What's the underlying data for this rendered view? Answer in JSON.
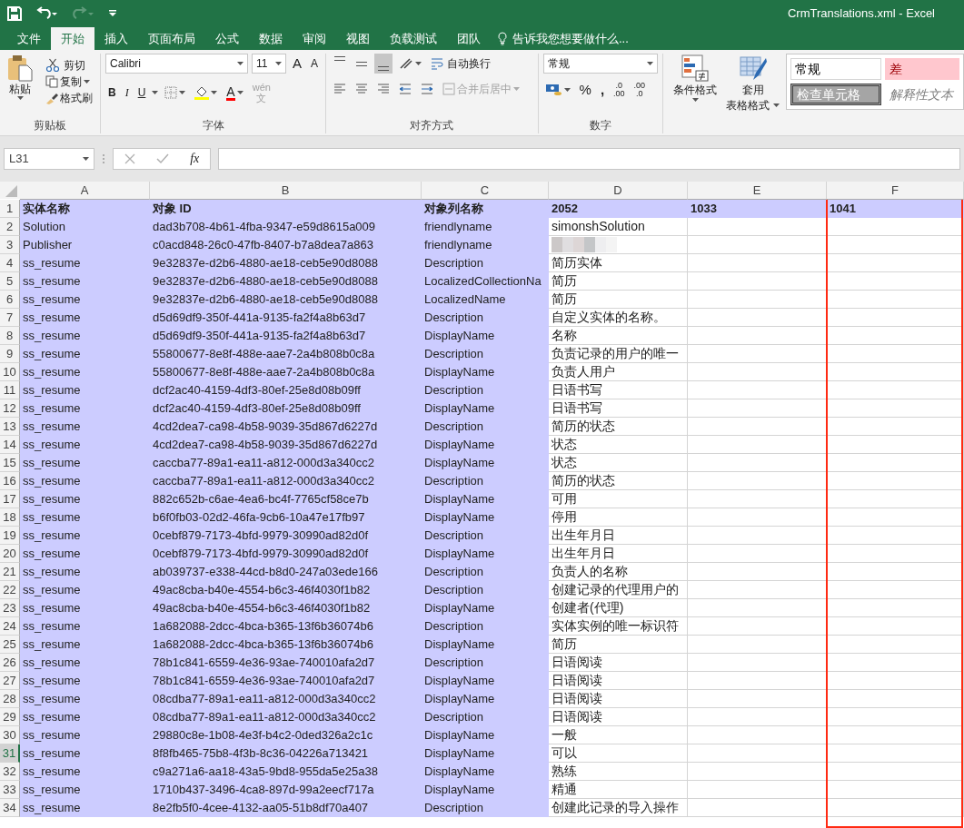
{
  "window": {
    "title": "CrmTranslations.xml - Excel"
  },
  "quick_access": [
    {
      "kind": "save",
      "disabled": false
    },
    {
      "kind": "undo",
      "disabled": false
    },
    {
      "kind": "redo",
      "disabled": true
    },
    {
      "kind": "customize",
      "disabled": false
    }
  ],
  "tabs": [
    {
      "label": "文件",
      "selected": false
    },
    {
      "label": "开始",
      "selected": true
    },
    {
      "label": "插入",
      "selected": false
    },
    {
      "label": "页面布局",
      "selected": false
    },
    {
      "label": "公式",
      "selected": false
    },
    {
      "label": "数据",
      "selected": false
    },
    {
      "label": "审阅",
      "selected": false
    },
    {
      "label": "视图",
      "selected": false
    },
    {
      "label": "负载测试",
      "selected": false
    },
    {
      "label": "团队",
      "selected": false
    }
  ],
  "tell_me": {
    "placeholder": "告诉我您想要做什么..."
  },
  "ribbon": {
    "clipboard": {
      "paste": "粘贴",
      "cut": "剪切",
      "copy": "复制",
      "format_painter": "格式刷",
      "label": "剪贴板"
    },
    "font": {
      "name": "Calibri",
      "size": "11",
      "grow": "A",
      "shrink": "A",
      "bold": "B",
      "italic": "I",
      "underline": "U",
      "font_color": "A",
      "phonetic_top": "wén",
      "phonetic_bottom": "文",
      "phonetic_disabled": true,
      "label": "字体"
    },
    "alignment": {
      "vertical": [
        {
          "selected": false
        },
        {
          "selected": false
        },
        {
          "selected": true
        }
      ],
      "wrap_text": "自动换行",
      "merge_center": "合并后居中",
      "merge_disabled": true,
      "label": "对齐方式"
    },
    "number": {
      "format": "常规",
      "percent": "%",
      "comma": ",",
      "inc_top": ".0",
      "inc_bottom": ".00",
      "dec_top": ".00",
      "dec_bottom": ".0",
      "label": "数字"
    },
    "styles": {
      "conditional": "条件格式",
      "format_table_top": "套用",
      "format_table_bottom": "表格格式",
      "gallery": [
        {
          "label": "常规",
          "kind": "normal"
        },
        {
          "label": "差",
          "kind": "bad"
        },
        {
          "label": "检查单元格",
          "kind": "check"
        },
        {
          "label": "解释性文本",
          "kind": "explanatory"
        }
      ]
    }
  },
  "name_box": {
    "value": "L31"
  },
  "formula_bar": {
    "function_label": "fx",
    "value_disabled": true
  },
  "sheet": {
    "columns": [
      {
        "label": "A",
        "highlighted": false
      },
      {
        "label": "B",
        "highlighted": false
      },
      {
        "label": "C",
        "highlighted": false
      },
      {
        "label": "D",
        "highlighted": false
      },
      {
        "label": "E",
        "highlighted": false
      },
      {
        "label": "F",
        "highlighted": true
      }
    ],
    "rows": [
      {
        "n": "1",
        "header": true,
        "selected": false,
        "cells": [
          "实体名称",
          "对象 ID",
          "对象列名称",
          "2052",
          "1033",
          "1041"
        ]
      },
      {
        "n": "2",
        "header": false,
        "selected": false,
        "cells": [
          "Solution",
          "dad3b708-4b61-4fba-9347-e59d8615a009",
          "friendlyname",
          "simonshSolution"
        ]
      },
      {
        "n": "3",
        "header": false,
        "selected": false,
        "blurred": true,
        "cells": [
          "Publisher",
          "c0acd848-26c0-47fb-8407-b7a8dea7a863",
          "friendlyname"
        ]
      },
      {
        "n": "4",
        "header": false,
        "selected": false,
        "cells": [
          "ss_resume",
          "9e32837e-d2b6-4880-ae18-ceb5e90d8088",
          "Description",
          "简历实体"
        ]
      },
      {
        "n": "5",
        "header": false,
        "selected": false,
        "cells": [
          "ss_resume",
          "9e32837e-d2b6-4880-ae18-ceb5e90d8088",
          "LocalizedCollectionNa",
          "简历"
        ]
      },
      {
        "n": "6",
        "header": false,
        "selected": false,
        "cells": [
          "ss_resume",
          "9e32837e-d2b6-4880-ae18-ceb5e90d8088",
          "LocalizedName",
          "简历"
        ]
      },
      {
        "n": "7",
        "header": false,
        "selected": false,
        "cells": [
          "ss_resume",
          "d5d69df9-350f-441a-9135-fa2f4a8b63d7",
          "Description",
          "自定义实体的名称。"
        ]
      },
      {
        "n": "8",
        "header": false,
        "selected": false,
        "cells": [
          "ss_resume",
          "d5d69df9-350f-441a-9135-fa2f4a8b63d7",
          "DisplayName",
          "名称"
        ]
      },
      {
        "n": "9",
        "header": false,
        "selected": false,
        "cells": [
          "ss_resume",
          "55800677-8e8f-488e-aae7-2a4b808b0c8a",
          "Description",
          "负责记录的用户的唯一"
        ]
      },
      {
        "n": "10",
        "header": false,
        "selected": false,
        "cells": [
          "ss_resume",
          "55800677-8e8f-488e-aae7-2a4b808b0c8a",
          "DisplayName",
          "负责人用户"
        ]
      },
      {
        "n": "11",
        "header": false,
        "selected": false,
        "cells": [
          "ss_resume",
          "dcf2ac40-4159-4df3-80ef-25e8d08b09ff",
          "Description",
          "日语书写"
        ]
      },
      {
        "n": "12",
        "header": false,
        "selected": false,
        "cells": [
          "ss_resume",
          "dcf2ac40-4159-4df3-80ef-25e8d08b09ff",
          "DisplayName",
          "日语书写"
        ]
      },
      {
        "n": "13",
        "header": false,
        "selected": false,
        "cells": [
          "ss_resume",
          "4cd2dea7-ca98-4b58-9039-35d867d6227d",
          "Description",
          "简历的状态"
        ]
      },
      {
        "n": "14",
        "header": false,
        "selected": false,
        "cells": [
          "ss_resume",
          "4cd2dea7-ca98-4b58-9039-35d867d6227d",
          "DisplayName",
          "状态"
        ]
      },
      {
        "n": "15",
        "header": false,
        "selected": false,
        "cells": [
          "ss_resume",
          "caccba77-89a1-ea11-a812-000d3a340cc2",
          "DisplayName",
          "状态"
        ]
      },
      {
        "n": "16",
        "header": false,
        "selected": false,
        "cells": [
          "ss_resume",
          "caccba77-89a1-ea11-a812-000d3a340cc2",
          "Description",
          "简历的状态"
        ]
      },
      {
        "n": "17",
        "header": false,
        "selected": false,
        "cells": [
          "ss_resume",
          "882c652b-c6ae-4ea6-bc4f-7765cf58ce7b",
          "DisplayName",
          "可用"
        ]
      },
      {
        "n": "18",
        "header": false,
        "selected": false,
        "cells": [
          "ss_resume",
          "b6f0fb03-02d2-46fa-9cb6-10a47e17fb97",
          "DisplayName",
          "停用"
        ]
      },
      {
        "n": "19",
        "header": false,
        "selected": false,
        "cells": [
          "ss_resume",
          "0cebf879-7173-4bfd-9979-30990ad82d0f",
          "Description",
          "出生年月日"
        ]
      },
      {
        "n": "20",
        "header": false,
        "selected": false,
        "cells": [
          "ss_resume",
          "0cebf879-7173-4bfd-9979-30990ad82d0f",
          "DisplayName",
          "出生年月日"
        ]
      },
      {
        "n": "21",
        "header": false,
        "selected": false,
        "cells": [
          "ss_resume",
          "ab039737-e338-44cd-b8d0-247a03ede166",
          "Description",
          "负责人的名称"
        ]
      },
      {
        "n": "22",
        "header": false,
        "selected": false,
        "cells": [
          "ss_resume",
          "49ac8cba-b40e-4554-b6c3-46f4030f1b82",
          "Description",
          "创建记录的代理用户的"
        ]
      },
      {
        "n": "23",
        "header": false,
        "selected": false,
        "cells": [
          "ss_resume",
          "49ac8cba-b40e-4554-b6c3-46f4030f1b82",
          "DisplayName",
          "创建者(代理)"
        ]
      },
      {
        "n": "24",
        "header": false,
        "selected": false,
        "cells": [
          "ss_resume",
          "1a682088-2dcc-4bca-b365-13f6b36074b6",
          "Description",
          "实体实例的唯一标识符"
        ]
      },
      {
        "n": "25",
        "header": false,
        "selected": false,
        "cells": [
          "ss_resume",
          "1a682088-2dcc-4bca-b365-13f6b36074b6",
          "DisplayName",
          "简历"
        ]
      },
      {
        "n": "26",
        "header": false,
        "selected": false,
        "cells": [
          "ss_resume",
          "78b1c841-6559-4e36-93ae-740010afa2d7",
          "Description",
          "日语阅读"
        ]
      },
      {
        "n": "27",
        "header": false,
        "selected": false,
        "cells": [
          "ss_resume",
          "78b1c841-6559-4e36-93ae-740010afa2d7",
          "DisplayName",
          "日语阅读"
        ]
      },
      {
        "n": "28",
        "header": false,
        "selected": false,
        "cells": [
          "ss_resume",
          "08cdba77-89a1-ea11-a812-000d3a340cc2",
          "DisplayName",
          "日语阅读"
        ]
      },
      {
        "n": "29",
        "header": false,
        "selected": false,
        "cells": [
          "ss_resume",
          "08cdba77-89a1-ea11-a812-000d3a340cc2",
          "Description",
          "日语阅读"
        ]
      },
      {
        "n": "30",
        "header": false,
        "selected": false,
        "cells": [
          "ss_resume",
          "29880c8e-1b08-4e3f-b4c2-0ded326a2c1c",
          "DisplayName",
          "一般"
        ]
      },
      {
        "n": "31",
        "header": false,
        "selected": true,
        "cells": [
          "ss_resume",
          "8f8fb465-75b8-4f3b-8c36-04226a713421",
          "DisplayName",
          "可以"
        ]
      },
      {
        "n": "32",
        "header": false,
        "selected": false,
        "cells": [
          "ss_resume",
          "c9a271a6-aa18-43a5-9bd8-955da5e25a38",
          "DisplayName",
          "熟练"
        ]
      },
      {
        "n": "33",
        "header": false,
        "selected": false,
        "cells": [
          "ss_resume",
          "1710b437-3496-4ca8-897d-99a2eecf717a",
          "DisplayName",
          "精通"
        ]
      },
      {
        "n": "34",
        "header": false,
        "selected": false,
        "cells": [
          "ss_resume",
          "8e2fb5f0-4cee-4132-aa05-51b8df70a407",
          "Description",
          "创建此记录的导入操作"
        ]
      }
    ]
  }
}
